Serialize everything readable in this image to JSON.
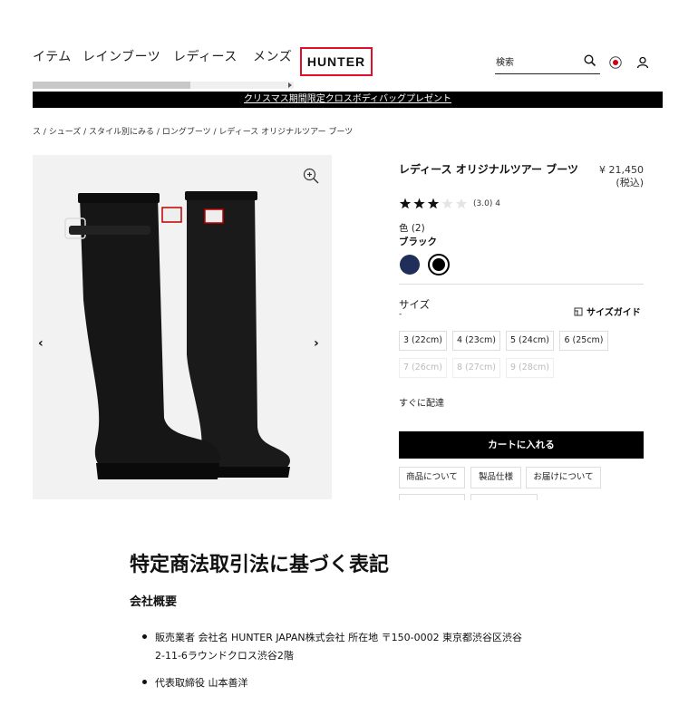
{
  "nav": {
    "items": [
      "イテム",
      "レインブーツ",
      "レディース",
      "メンズ"
    ],
    "logo": "HUNTER",
    "search_placeholder": "検索",
    "icons": [
      "search-icon",
      "flag-icon",
      "user-icon"
    ]
  },
  "promo": {
    "text": "クリスマス期間限定クロスボディバッグプレゼント"
  },
  "breadcrumb": {
    "text": "ス / シューズ / スタイル別にみる / ロングブーツ / レディース オリジナルツアー ブーツ"
  },
  "product": {
    "title": "レディース オリジナルツアー ブーツ",
    "price": "¥ 21,450",
    "price_note": "(税込)",
    "rating": {
      "value": 3,
      "max": 5,
      "text": "(3.0) 4"
    },
    "color_label": "色 (2)",
    "color_value": "ブラック",
    "swatches": [
      {
        "name": "navy",
        "color": "#1f2f5a"
      },
      {
        "name": "black",
        "color": "#000000",
        "selected": true
      }
    ],
    "size_label": "サイズ",
    "size_value": "-",
    "size_guide": "サイズガイド",
    "sizes": [
      {
        "label": "3 (22cm)",
        "available": true
      },
      {
        "label": "4 (23cm)",
        "available": true
      },
      {
        "label": "5 (24cm)",
        "available": true
      },
      {
        "label": "6 (25cm)",
        "available": true
      },
      {
        "label": "7 (26cm)",
        "available": false
      },
      {
        "label": "8 (27cm)",
        "available": false
      },
      {
        "label": "9 (28cm)",
        "available": false
      }
    ],
    "delivery": "すぐに配達",
    "add_to_cart": "カートに入れる",
    "tabs": [
      "商品について",
      "製品仕様",
      "お届けについて"
    ]
  },
  "legal": {
    "heading": "特定商法取引法に基づく表記",
    "subheading": "会社概要",
    "items": [
      "販売業者 会社名 HUNTER JAPAN株式会社 所在地 〒150-0002 東京都渋谷区渋谷",
      "2-11-6ラウンドクロス渋谷2階",
      "代表取締役 山本善洋"
    ]
  }
}
